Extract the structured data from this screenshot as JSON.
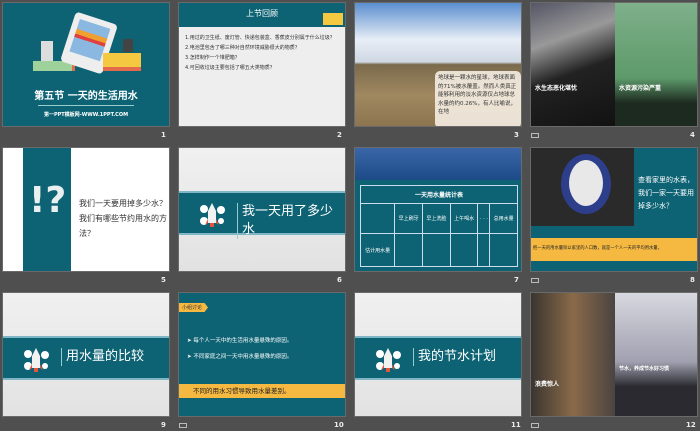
{
  "slides": [
    {
      "number": "1",
      "title": "第五节 一天的生活用水",
      "subtitle": "第一PPT模板网-WWW.1PPT.COM"
    },
    {
      "number": "2",
      "header": "上节回顾",
      "questions": [
        "1.用过的卫生纸、废灯管、快递包装盒、香蕉皮分别属于什么垃圾？",
        "2.电池里包含了哪三种对自然环境威胁很大的物质？",
        "3.怎样制作一个堆肥箱？",
        "4.可回收垃圾主要包括了哪五大类物质？"
      ]
    },
    {
      "number": "3",
      "caption": "地球是一颗水的星球，地球表面的71%被水覆盖。然而人类真正能够利用的淡水资源仅占地球总水量的约0.26%，有人比喻说，在地"
    },
    {
      "number": "4",
      "left_title": "水生态恶化堪忧",
      "right_title": "水资源污染严重"
    },
    {
      "number": "5",
      "mark": "!?",
      "text": "我们一天要用掉多少水？我们有哪些节约用水的方法？"
    },
    {
      "number": "6",
      "title": "我一天用了多少水"
    },
    {
      "number": "7",
      "table_title": "一天用水量统计表",
      "columns": [
        "",
        "早上刷牙",
        "早上洗脸",
        "上午喝水",
        "· · ·",
        "总用水量"
      ],
      "row_label": "估计用水量"
    },
    {
      "number": "8",
      "text": "查看家里的水表，我们一家一天要用掉多少水？",
      "note": "把一天的用水量除以家里的人口数，就是一个人一天的平均用水量。"
    },
    {
      "number": "9",
      "title": "用水量的比较"
    },
    {
      "number": "10",
      "tag": "小组讨论",
      "bullets": [
        "每个人一天中的生活用水量悬殊的原因。",
        "不同家庭之间一天中用水量悬殊的原因。"
      ],
      "conclusion": "不同的用水习惯导致用水量差别。"
    },
    {
      "number": "11",
      "title": "我的节水计划"
    },
    {
      "number": "12",
      "left_title": "浪费惊人",
      "right_title": "节水，养成节水好习惯"
    }
  ]
}
